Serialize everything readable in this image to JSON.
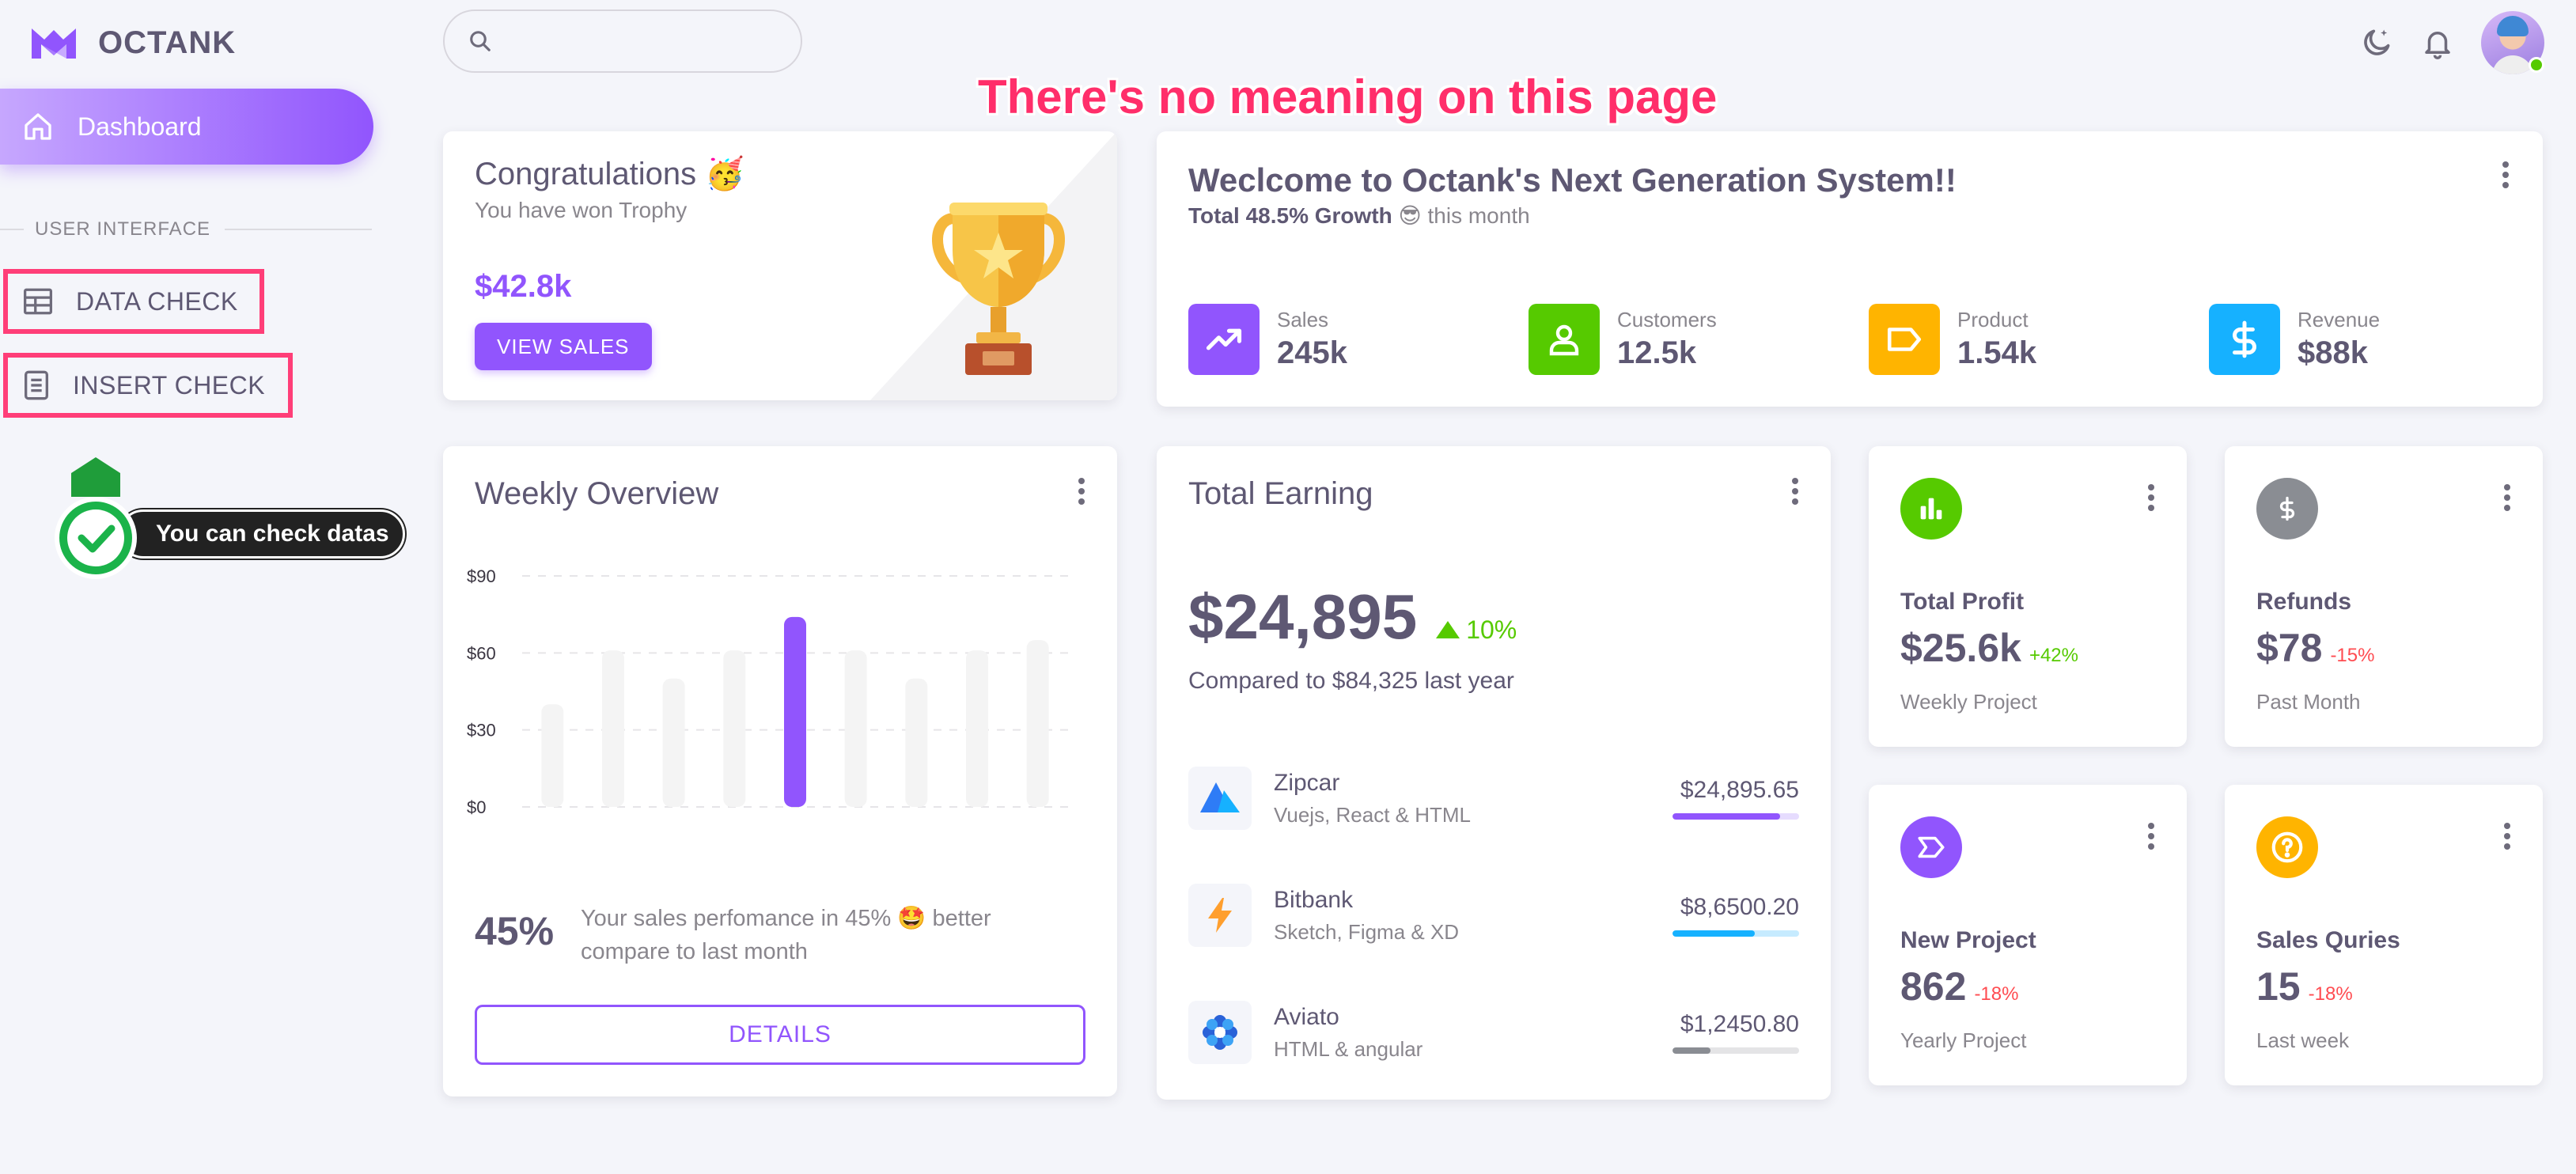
{
  "brand": {
    "name": "OCTANK"
  },
  "sidebar": {
    "dashboard_label": "Dashboard",
    "section_title": "USER INTERFACE",
    "items": [
      {
        "label": "DATA CHECK",
        "icon": "table-icon"
      },
      {
        "label": "INSERT CHECK",
        "icon": "form-icon"
      }
    ],
    "tooltip": "You can check datas"
  },
  "header": {
    "search_placeholder": "",
    "icons": [
      "moon-icon",
      "bell-icon",
      "avatar"
    ]
  },
  "notice": "There's no meaning on this page",
  "congrats": {
    "title": "Congratulations 🥳",
    "subtitle": "You have won Trophy",
    "amount": "$42.8k",
    "button": "VIEW SALES"
  },
  "welcome": {
    "title": "Weclcome to Octank's Next Generation System!!",
    "growth_bold": "Total 48.5% Growth",
    "growth_rest": "😎 this month",
    "stats": [
      {
        "label": "Sales",
        "value": "245k",
        "color": "#9155fd",
        "icon": "trending-up-icon"
      },
      {
        "label": "Customers",
        "value": "12.5k",
        "color": "#56ca00",
        "icon": "user-icon"
      },
      {
        "label": "Product",
        "value": "1.54k",
        "color": "#ffb400",
        "icon": "tag-icon"
      },
      {
        "label": "Revenue",
        "value": "$88k",
        "color": "#16b1ff",
        "icon": "dollar-icon"
      }
    ]
  },
  "weekly": {
    "title": "Weekly Overview",
    "percent": "45%",
    "description": "Your sales perfomance in 45% 🤩 better compare to last month",
    "button": "DETAILS"
  },
  "chart_data": {
    "type": "bar",
    "categories": [
      "",
      "",
      "",
      "",
      "",
      "",
      "",
      "",
      ""
    ],
    "values": [
      40,
      61,
      50,
      61,
      74,
      61,
      50,
      61,
      65
    ],
    "highlight_index": 4,
    "ytick_labels": [
      "$90",
      "$60",
      "$30",
      "$0"
    ],
    "yticks": [
      90,
      60,
      30,
      0
    ],
    "ylim": [
      0,
      90
    ],
    "title": "",
    "xlabel": "",
    "ylabel": "",
    "colors": {
      "bar": "#f4f4f4",
      "highlight": "#9155fd"
    }
  },
  "earning": {
    "title": "Total Earning",
    "amount": "$24,895",
    "change": "10%",
    "compare": "Compared to $84,325 last year",
    "items": [
      {
        "name": "Zipcar",
        "sub": "Vuejs, React & HTML",
        "amount": "$24,895.65",
        "progress": 0.85,
        "color": "#9155fd",
        "track": "#e6dcfe",
        "icon": "zipcar-logo"
      },
      {
        "name": "Bitbank",
        "sub": "Sketch, Figma & XD",
        "amount": "$8,6500.20",
        "progress": 0.65,
        "color": "#16b1ff",
        "track": "#c6ebff",
        "icon": "bolt-icon"
      },
      {
        "name": "Aviato",
        "sub": "HTML & angular",
        "amount": "$1,2450.80",
        "progress": 0.3,
        "color": "#8a8d93",
        "track": "#e4e4e6",
        "icon": "aviato-logo"
      }
    ]
  },
  "mini_cards": [
    {
      "label": "Total Profit",
      "value": "$25.6k",
      "change": "+42%",
      "change_color": "#56ca00",
      "sub": "Weekly Project",
      "icon_bg": "#56ca00",
      "icon": "bar-chart-icon"
    },
    {
      "label": "Refunds",
      "value": "$78",
      "change": "-15%",
      "change_color": "#ff4c51",
      "sub": "Past Month",
      "icon_bg": "#8a8d93",
      "icon": "dollar-circle-icon"
    },
    {
      "label": "New Project",
      "value": "862",
      "change": "-18%",
      "change_color": "#ff4c51",
      "sub": "Yearly Project",
      "icon_bg": "#9155fd",
      "icon": "label-icon"
    },
    {
      "label": "Sales Quries",
      "value": "15",
      "change": "-18%",
      "change_color": "#ff4c51",
      "sub": "Last week",
      "icon_bg": "#ffb400",
      "icon": "help-circle-icon"
    }
  ]
}
